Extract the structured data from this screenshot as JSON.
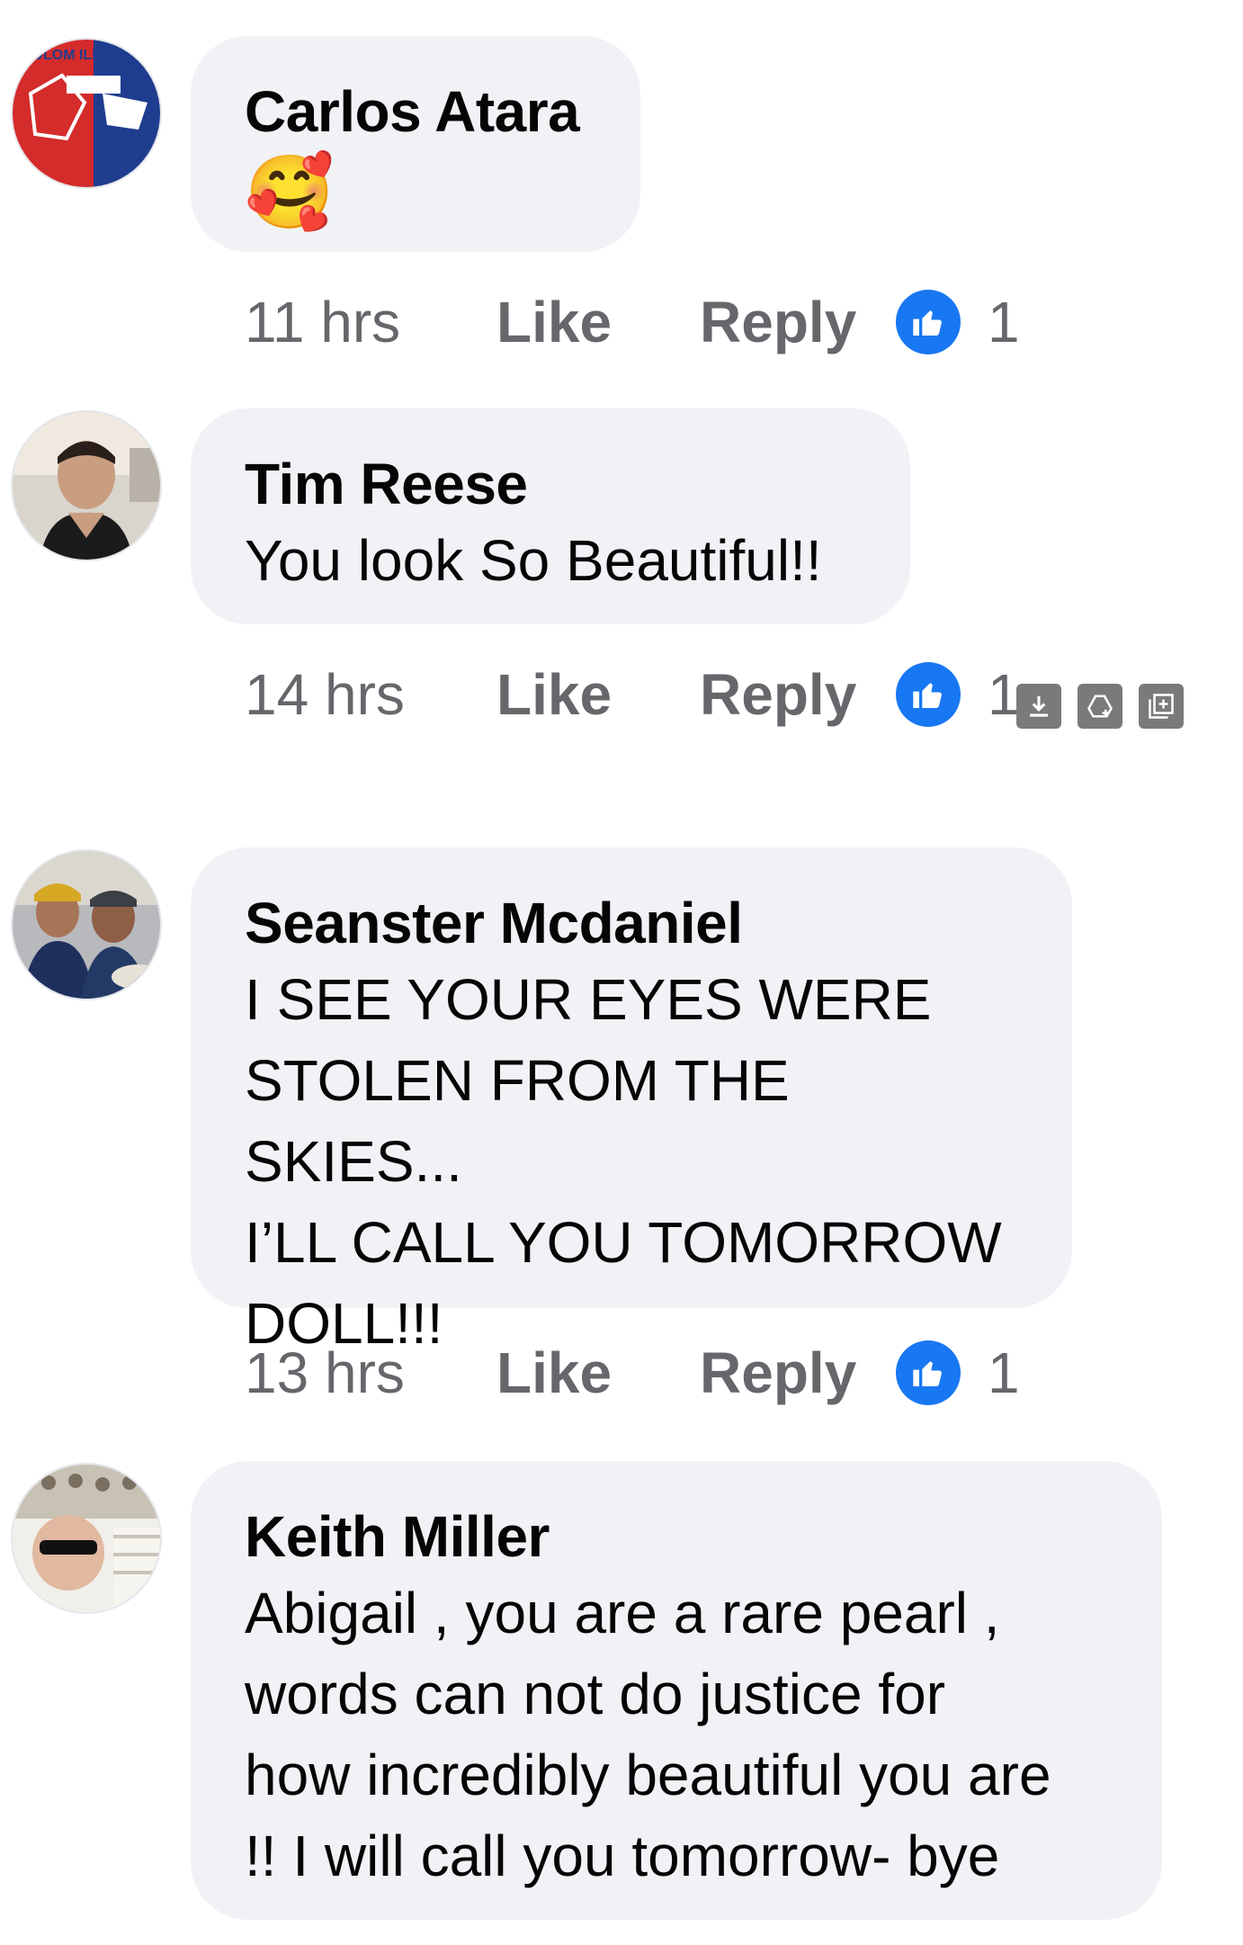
{
  "comments": [
    {
      "author": "Carlos Atara",
      "text": "",
      "emoji": "🥰",
      "time": "11 hrs",
      "like_label": "Like",
      "reply_label": "Reply",
      "reaction_count": "1",
      "avatar_text": "COLOM ILLA"
    },
    {
      "author": "Tim Reese",
      "text": "You look So Beautiful!!",
      "time": "14 hrs",
      "like_label": "Like",
      "reply_label": "Reply",
      "reaction_count": "1"
    },
    {
      "author": "Seanster Mcdaniel",
      "text": "I SEE YOUR EYES WERE\nSTOLEN FROM THE SKIES...\nI’LL CALL YOU TOMORROW\nDOLL!!!",
      "time": "13 hrs",
      "like_label": "Like",
      "reply_label": "Reply",
      "reaction_count": "1"
    },
    {
      "author": "Keith Miller",
      "text": "Abigail , you are a rare pearl ,\nwords can not do justice for\nhow incredibly beautiful you are\n!! I will call you tomorrow- bye",
      "time": "",
      "like_label": "",
      "reply_label": "",
      "reaction_count": ""
    }
  ],
  "colors": {
    "bubble": "#f0f2f5",
    "meta_text": "#65676b",
    "like_reaction": "#1877f2"
  },
  "icons": {
    "reaction": "thumbs-up-icon",
    "overlay_tools": [
      "download-icon",
      "drive-upload-icon",
      "add-to-collection-icon"
    ]
  }
}
